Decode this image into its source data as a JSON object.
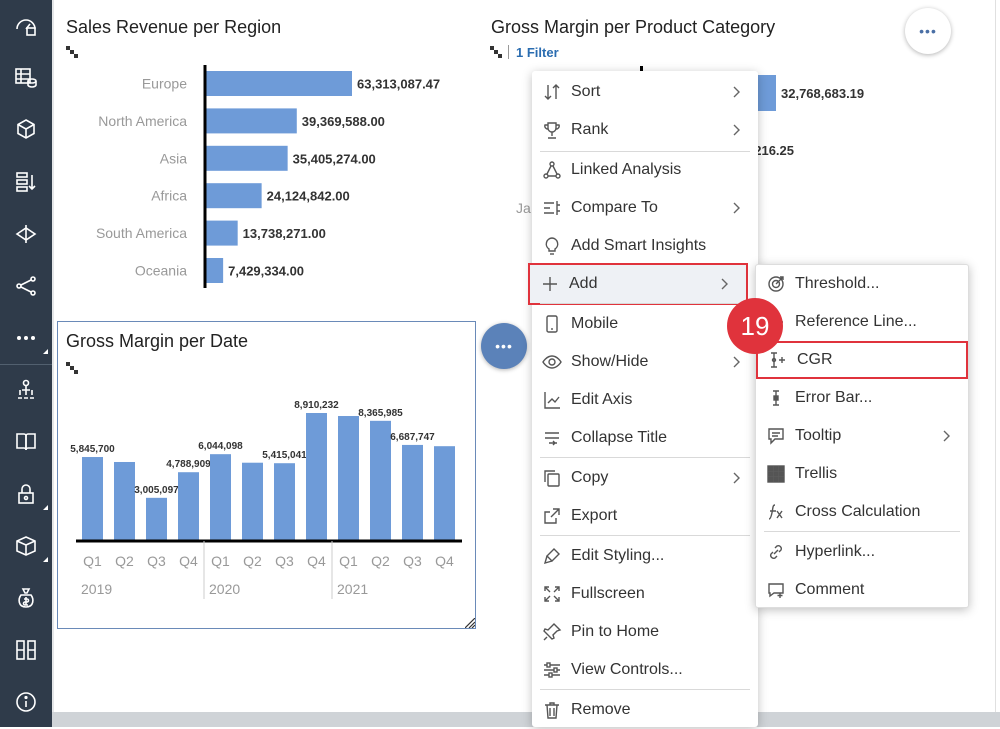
{
  "sidebar": {
    "items": [
      {
        "icon": "home-dashboard-icon"
      },
      {
        "icon": "data-table-icon"
      },
      {
        "icon": "cube-model-icon"
      },
      {
        "icon": "list-sort-icon"
      },
      {
        "icon": "data-flow-icon"
      },
      {
        "icon": "share-connections-icon"
      },
      {
        "icon": "more-ellipsis-icon"
      },
      {
        "icon": "user-hierarchy-icon"
      },
      {
        "icon": "book-icon"
      },
      {
        "icon": "lock-security-icon"
      },
      {
        "icon": "package-box-icon"
      },
      {
        "icon": "money-bag-icon"
      },
      {
        "icon": "tiles-grid-icon"
      },
      {
        "icon": "info-icon"
      }
    ]
  },
  "widgets": {
    "sales_revenue": {
      "title": "Sales Revenue per Region"
    },
    "gross_margin_product": {
      "title": "Gross Margin per Product Category",
      "filter": "1 Filter",
      "partial_value_1": "32,768,683.19",
      "partial_value_2": "216.25",
      "partial_label": "Ja"
    },
    "gross_margin_date": {
      "title": "Gross Margin per Date"
    }
  },
  "more_button": {
    "label": "•••"
  },
  "chart_data": [
    {
      "type": "bar",
      "orientation": "horizontal",
      "title": "Sales Revenue per Region",
      "categories": [
        "Europe",
        "North America",
        "Asia",
        "Africa",
        "South America",
        "Oceania"
      ],
      "values": [
        63313087.47,
        39369588.0,
        35405274.0,
        24124842.0,
        13738271.0,
        7429334.0
      ],
      "labels": [
        "63,313,087.47",
        "39,369,588.00",
        "35,405,274.00",
        "24,124,842.00",
        "13,738,271.00",
        "7,429,334.00"
      ],
      "color": "#6e9bd8"
    },
    {
      "type": "bar",
      "title": "Gross Margin per Date",
      "categories": [
        "Q1",
        "Q2",
        "Q3",
        "Q4",
        "Q1",
        "Q2",
        "Q3",
        "Q4",
        "Q1",
        "Q2",
        "Q3",
        "Q4"
      ],
      "groups": [
        "2019",
        "2020",
        "2021"
      ],
      "values": [
        5845700,
        5500000,
        3005097,
        4788909,
        6044098,
        5450000,
        5415041,
        8910232,
        8700000,
        8365985,
        6687747,
        6600000
      ],
      "labels": [
        "5,845,700",
        "",
        "3,005,097",
        "4,788,909",
        "6,044,098",
        "",
        "5,415,041",
        "8,910,232",
        "",
        "8,365,985",
        "6,687,747",
        ""
      ],
      "color": "#6e9bd8"
    }
  ],
  "context_menu": {
    "items": [
      {
        "label": "Sort",
        "icon": "sort-icon",
        "submenu": true
      },
      {
        "label": "Rank",
        "icon": "trophy-icon",
        "submenu": true
      },
      {
        "label": "Linked Analysis",
        "icon": "linked-analysis-icon",
        "submenu": false
      },
      {
        "label": "Compare To",
        "icon": "compare-icon",
        "submenu": true
      },
      {
        "label": "Add Smart Insights",
        "icon": "lightbulb-icon",
        "submenu": false
      },
      {
        "label": "Add",
        "icon": "plus-icon",
        "submenu": true
      },
      {
        "label": "Mobile",
        "icon": "mobile-icon",
        "submenu": false
      },
      {
        "label": "Show/Hide",
        "icon": "eye-icon",
        "submenu": true
      },
      {
        "label": "Edit Axis",
        "icon": "axis-icon",
        "submenu": false
      },
      {
        "label": "Collapse Title",
        "icon": "collapse-icon",
        "submenu": false
      },
      {
        "label": "Copy",
        "icon": "copy-icon",
        "submenu": true
      },
      {
        "label": "Export",
        "icon": "export-icon",
        "submenu": false
      },
      {
        "label": "Edit Styling...",
        "icon": "paint-icon",
        "submenu": false
      },
      {
        "label": "Fullscreen",
        "icon": "fullscreen-icon",
        "submenu": false
      },
      {
        "label": "Pin to Home",
        "icon": "pin-icon",
        "submenu": false
      },
      {
        "label": "View Controls...",
        "icon": "view-controls-icon",
        "submenu": false
      },
      {
        "label": "Remove",
        "icon": "trash-icon",
        "submenu": false
      }
    ]
  },
  "add_submenu": {
    "items": [
      {
        "label": "Threshold...",
        "icon": "target-icon",
        "submenu": false
      },
      {
        "label": "Reference Line...",
        "icon": "reference-line-icon",
        "submenu": false
      },
      {
        "label": "CGR",
        "icon": "cgr-icon",
        "submenu": false
      },
      {
        "label": "Error Bar...",
        "icon": "error-bar-icon",
        "submenu": false
      },
      {
        "label": "Tooltip",
        "icon": "tooltip-icon",
        "submenu": true
      },
      {
        "label": "Trellis",
        "icon": "trellis-grid-icon",
        "submenu": false
      },
      {
        "label": "Cross Calculation",
        "icon": "fx-icon",
        "submenu": false
      },
      {
        "label": "Hyperlink...",
        "icon": "link-icon",
        "submenu": false
      },
      {
        "label": "Comment",
        "icon": "comment-icon",
        "submenu": false
      }
    ]
  },
  "step_badge": {
    "label": "19"
  },
  "colors": {
    "accent": "#e0333c",
    "sidebar": "#2f3b4a",
    "bar": "#6e9bd8"
  }
}
